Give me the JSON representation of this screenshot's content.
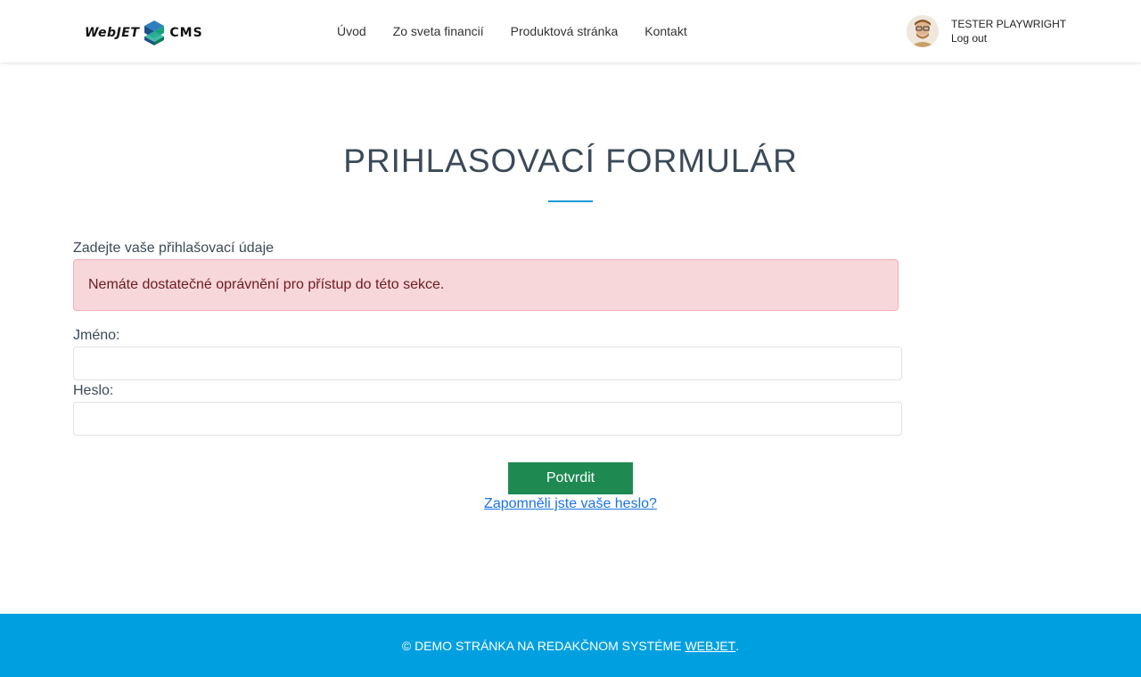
{
  "header": {
    "logo": {
      "text_left": "WebJET",
      "text_right": "CMS"
    },
    "nav": [
      {
        "label": "Úvod"
      },
      {
        "label": "Zo sveta financií"
      },
      {
        "label": "Produktová stránka"
      },
      {
        "label": "Kontakt"
      }
    ],
    "user": {
      "name": "TESTER PLAYWRIGHT",
      "logout_label": "Log out"
    }
  },
  "main": {
    "title": "PRIHLASOVACÍ FORMULÁR",
    "intro": "Zadejte vaše přihlašovací údaje",
    "alert": "Nemáte dostatečné oprávnění pro přístup do této sekce.",
    "username_label": "Jméno:",
    "username_value": "",
    "password_label": "Heslo:",
    "password_value": "",
    "submit_label": "Potvrdit",
    "forgot_label": "Zapomněli jste vaše heslo?"
  },
  "footer": {
    "text_prefix": "© DEMO STRÁNKA NA REDAKČNOM SYSTÉME ",
    "link_label": "WEBJET",
    "text_suffix": "."
  },
  "colors": {
    "accent": "#1a9ad6",
    "footer_bg": "#00a0e0",
    "submit_bg": "#1e8a52",
    "alert_bg": "#f8d7da",
    "alert_text": "#6b1a22",
    "link": "#1a73e8"
  },
  "icons": {
    "logo_mark": "webjet-cube-icon",
    "avatar": "user-avatar-icon"
  }
}
